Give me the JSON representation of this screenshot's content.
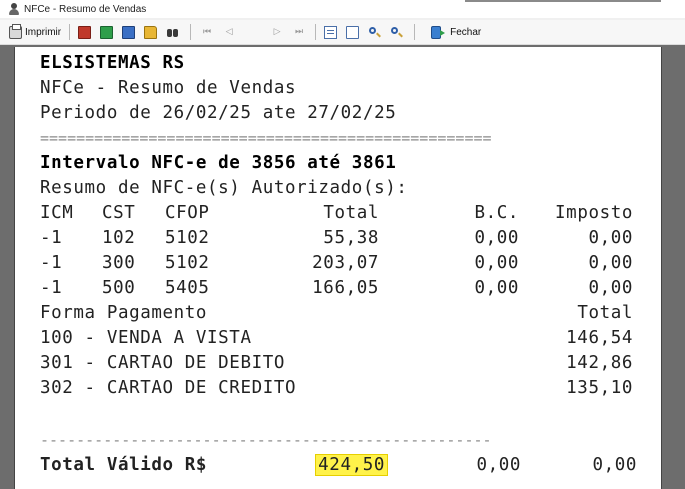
{
  "window": {
    "title": "NFCe - Resumo de Vendas"
  },
  "toolbar": {
    "print_label": "Imprimir",
    "close_label": "Fechar",
    "nav_first": "⏮",
    "nav_prev": "◁",
    "nav_next": "▷",
    "nav_last": "⏭"
  },
  "report": {
    "company": "ELSISTEMAS RS",
    "subtitle": "NFCe - Resumo de Vendas",
    "period": "Periodo de 26/02/25 ate 27/02/25",
    "separator": "==================================================",
    "interval": "Intervalo NFC-e de 3856 até 3861",
    "authorized_label": "Resumo de NFC-e(s) Autorizado(s):",
    "tax_headers": {
      "icm": "ICM",
      "cst": "CST",
      "cfop": "CFOP",
      "total": "Total",
      "bc": "B.C.",
      "imposto": "Imposto"
    },
    "tax_rows": [
      {
        "icm": "-1",
        "cst": "102",
        "cfop": "5102",
        "total": "55,38",
        "bc": "0,00",
        "imposto": "0,00"
      },
      {
        "icm": "-1",
        "cst": "300",
        "cfop": "5102",
        "total": "203,07",
        "bc": "0,00",
        "imposto": "0,00"
      },
      {
        "icm": "-1",
        "cst": "500",
        "cfop": "5405",
        "total": "166,05",
        "bc": "0,00",
        "imposto": "0,00"
      }
    ],
    "payment_header": {
      "label": "Forma Pagamento",
      "total": "Total"
    },
    "payments": [
      {
        "label": "100 - VENDA A VISTA",
        "total": "146,54"
      },
      {
        "label": "301 - CARTAO DE DEBITO",
        "total": "142,86"
      },
      {
        "label": "302 - CARTAO DE CREDITO",
        "total": "135,10"
      }
    ],
    "dash_separator": "--------------------------------------------------",
    "footer": {
      "label": "Total Válido R$",
      "total": "424,50",
      "bc": "0,00",
      "imposto": "0,00"
    }
  },
  "colors": {
    "highlight": "#fff24a",
    "preview_background": "#6d6d6d"
  }
}
